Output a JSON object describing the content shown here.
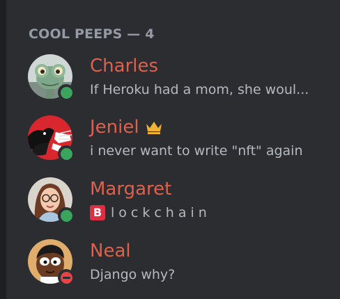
{
  "group": {
    "title": "COOL PEEPS — 4"
  },
  "members": [
    {
      "name": "Charles",
      "activity": "If Heroku had a mom, she woul...",
      "status": "online",
      "avatar_icon": "chameleon-avatar"
    },
    {
      "name": "Jeniel",
      "activity": "i never want to write \"nft\" again",
      "status": "online",
      "badge_icon": "crown-icon",
      "avatar_icon": "dog-and-hand-avatar"
    },
    {
      "name": "Margaret",
      "activity_emoji": "B",
      "activity": "lockchain",
      "status": "online",
      "avatar_icon": "woman-with-glasses-avatar"
    },
    {
      "name": "Neal",
      "activity": "Django why?",
      "status": "dnd",
      "avatar_icon": "cartoon-man-avatar"
    }
  ],
  "colors": {
    "background": "#2b2d31",
    "username": "#e0604b",
    "activity_text": "#b5bac1",
    "header_text": "#949ba4",
    "online": "#3ba55d",
    "dnd": "#ed4245",
    "crown": "#f0b232"
  }
}
